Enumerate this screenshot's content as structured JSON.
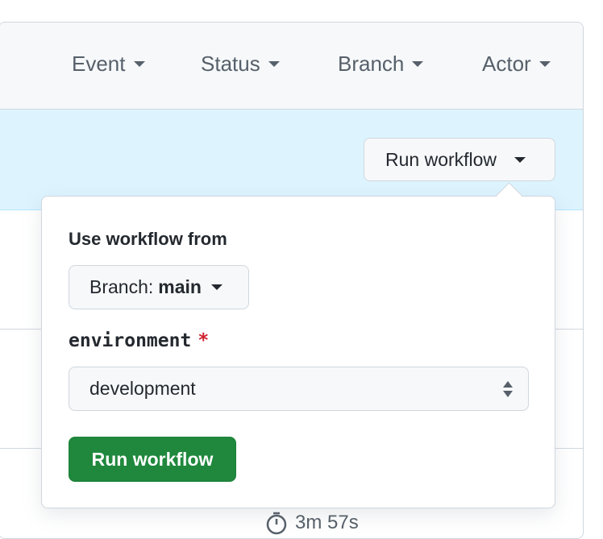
{
  "filters": {
    "event": "Event",
    "status": "Status",
    "branch": "Branch",
    "actor": "Actor"
  },
  "toolbar": {
    "run_workflow_label": "Run workflow"
  },
  "dialog": {
    "title": "Use workflow from",
    "branch_prefix": "Branch:",
    "branch_value": "main",
    "env_label": "environment",
    "required_mark": "*",
    "env_value": "development",
    "submit_label": "Run workflow"
  },
  "run": {
    "duration": "3m 57s"
  },
  "colors": {
    "banner_bg": "#ddf4ff",
    "primary_green": "#1f883d",
    "required_red": "#cf222e"
  },
  "icons": {
    "caret": "triangle-down",
    "select": "up-down-arrows",
    "timer": "stopwatch"
  }
}
